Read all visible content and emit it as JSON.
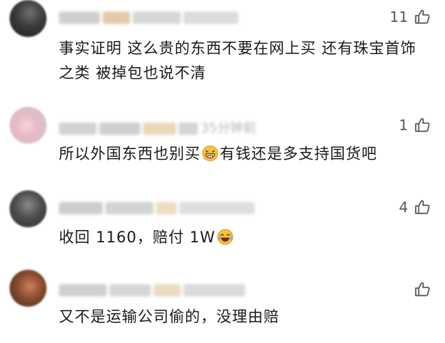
{
  "comments": [
    {
      "like_count": "11",
      "text": "事实证明 这么贵的东西不要在网上买 还有珠宝首饰之类 被掉包也说不清"
    },
    {
      "like_count": "1",
      "meta_time": "35分钟前",
      "text_before": "所以外国东西也别买",
      "text_after": "有钱还是多支持国货吧"
    },
    {
      "like_count": "4",
      "text_before": "收回 1160，赔付 1W"
    },
    {
      "like_count": "",
      "text": "又不是运输公司偷的，没理由赔"
    }
  ],
  "colors": {
    "text": "#1a1a1a",
    "meta": "#b4b4b4",
    "icon": "#555555"
  },
  "icons": [
    "thumbs-up-icon",
    "grin-emoji-icon",
    "laugh-cry-emoji-icon"
  ]
}
